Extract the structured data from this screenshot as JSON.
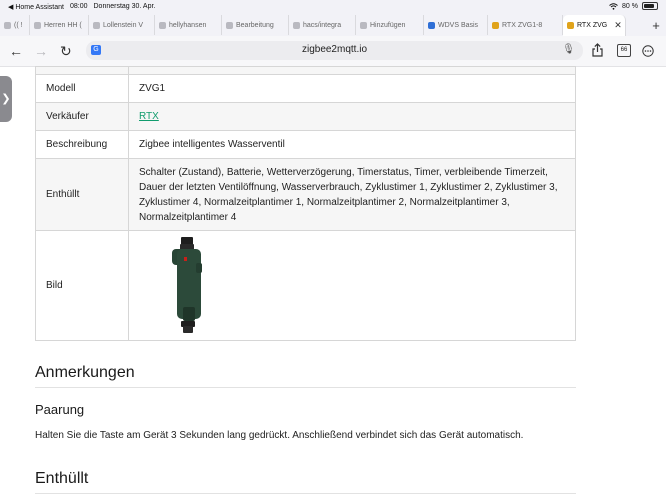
{
  "status": {
    "back_app": "◀ Home Assistant",
    "time": "08:00",
    "date": "Donnerstag 30. Apr.",
    "battery": "80 %"
  },
  "tabs": [
    {
      "label": "(( !"
    },
    {
      "label": "Herren HH ("
    },
    {
      "label": "Lollenstein V"
    },
    {
      "label": "hellyhansen"
    },
    {
      "label": "Bearbeitung"
    },
    {
      "label": "hacs/integra"
    },
    {
      "label": "Hinzufügen"
    },
    {
      "label": "WDVS Basis"
    },
    {
      "label": "RTX ZVG1-8"
    },
    {
      "label": "RTX ZVG"
    }
  ],
  "address": {
    "url": "zigbee2mqtt.io",
    "tab_count": "66"
  },
  "specs": {
    "rows": [
      {
        "key": "Modell",
        "value": "ZVG1"
      },
      {
        "key": "Verkäufer",
        "value": "RTX"
      },
      {
        "key": "Beschreibung",
        "value": "Zigbee intelligentes Wasserventil"
      },
      {
        "key": "Enthüllt",
        "value_lines": [
          "Schalter (Zustand), Batterie, Wetterverzögerung, Timerstatus, Timer, verbleibende Timerzeit,",
          "Dauer der letzten Ventilöffnung, Wasserverbrauch, Zyklustimer 1, Zyklustimer 2, Zyklustimer 3,",
          "Zyklustimer 4, Normalzeitplantimer 1, Normalzeitplantimer 2, Normalzeitplantimer 3,",
          "Normalzeitplantimer 4"
        ]
      },
      {
        "key": "Bild"
      }
    ]
  },
  "notes": {
    "heading": "Anmerkungen",
    "pairing_heading": "Paarung",
    "pairing_text": "Halten Sie die Taste am Gerät 3 Sekunden lang gedrückt. Anschließend verbindet sich das Gerät automatisch."
  },
  "exposes_heading": "Enthüllt",
  "colors": {
    "link": "#119c6e",
    "device_body": "#2c4a3a",
    "device_red": "#c8201a"
  }
}
